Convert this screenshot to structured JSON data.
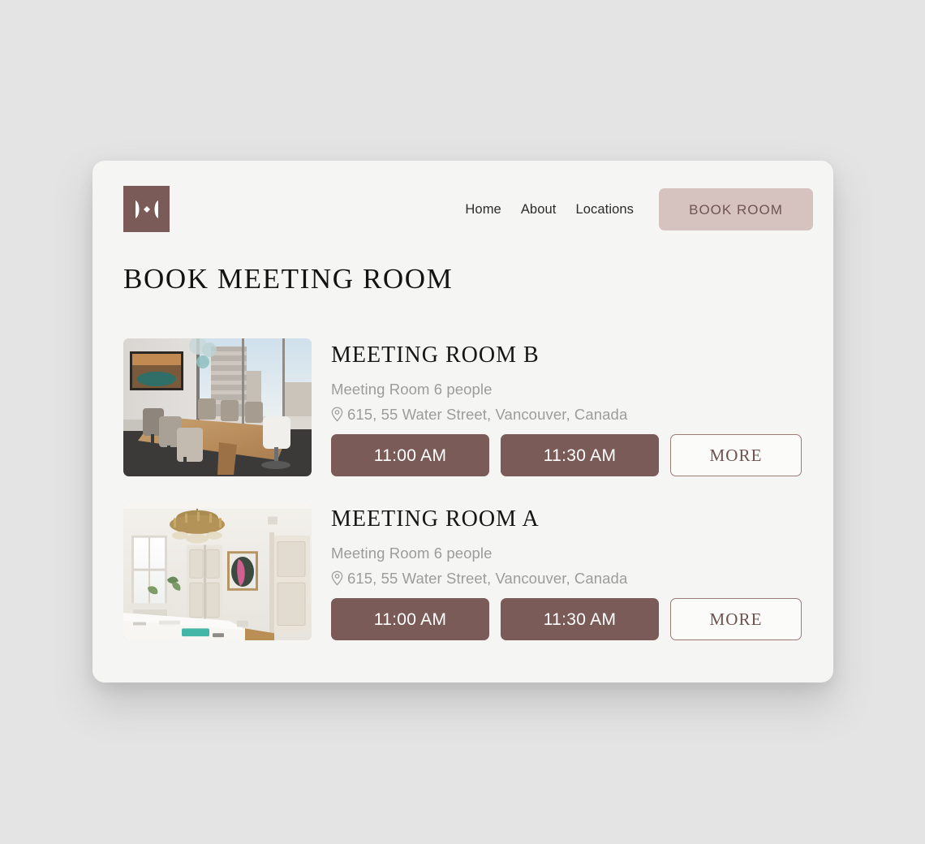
{
  "colors": {
    "page_background": "#e4e4e4",
    "panel_background": "#f5f5f4",
    "brand_brown": "#7b5b57",
    "accent_pink": "#d6c2be",
    "muted_text": "#9c9c9c",
    "heading_text": "#131313"
  },
  "header": {
    "logo_name": "brand-logo-mark",
    "nav": [
      {
        "label": "Home"
      },
      {
        "label": "About"
      },
      {
        "label": "Locations"
      }
    ],
    "cta": {
      "label": "BOOK ROOM"
    }
  },
  "main": {
    "title": "BOOK MEETING ROOM",
    "rooms": [
      {
        "name": "MEETING ROOM B",
        "capacity": "Meeting Room 6 people",
        "address": "615, 55 Water Street, Vancouver, Canada",
        "photo_alt": "modern-conference-room-with-city-view",
        "slots": [
          {
            "label": "11:00 AM"
          },
          {
            "label": "11:30 AM"
          }
        ],
        "more_label": "MORE"
      },
      {
        "name": "MEETING ROOM A",
        "capacity": "Meeting Room 6 people",
        "address": "615, 55 Water Street, Vancouver, Canada",
        "photo_alt": "classic-white-room-with-chandelier",
        "slots": [
          {
            "label": "11:00 AM"
          },
          {
            "label": "11:30 AM"
          }
        ],
        "more_label": "MORE"
      }
    ]
  }
}
